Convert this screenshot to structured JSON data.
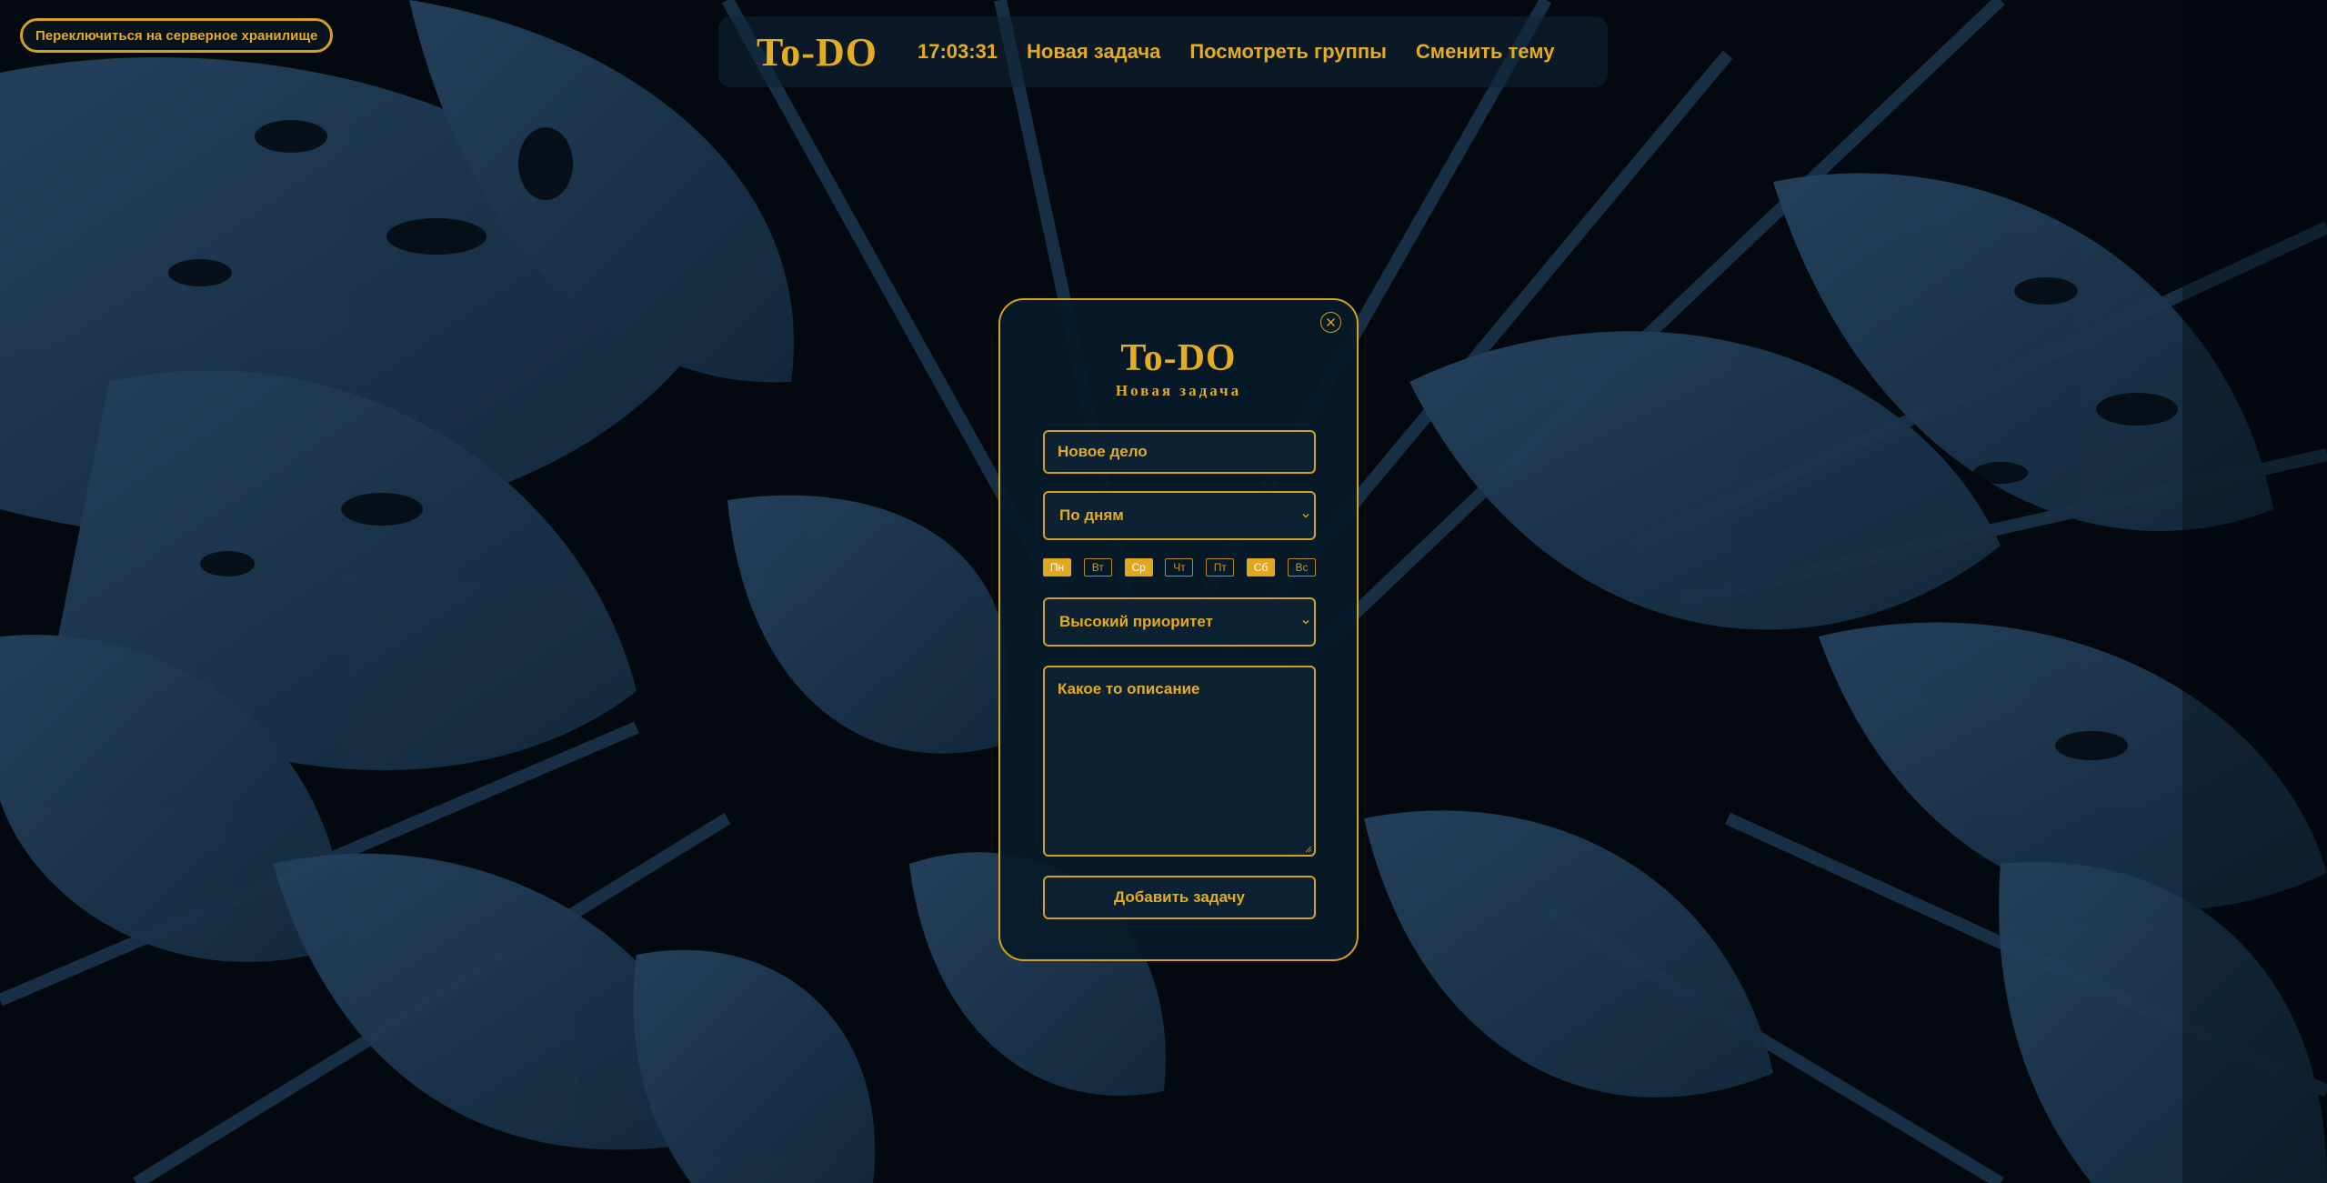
{
  "storage_switch": {
    "label": "Переключиться на серверное хранилище"
  },
  "nav": {
    "brand": "To-DO",
    "clock": "17:03:31",
    "new_task": "Новая задача",
    "view_groups": "Посмотреть группы",
    "change_theme": "Сменить тему"
  },
  "modal": {
    "title": "To-DO",
    "subtitle": "Новая задача",
    "task_name_value": "Новое дело",
    "repeat_select_value": "По дням",
    "days": [
      {
        "label": "Пн",
        "selected": true
      },
      {
        "label": "Вт",
        "selected": false
      },
      {
        "label": "Ср",
        "selected": true
      },
      {
        "label": "Чт",
        "selected": false
      },
      {
        "label": "Пт",
        "selected": false
      },
      {
        "label": "Сб",
        "selected": true
      },
      {
        "label": "Вс",
        "selected": false
      }
    ],
    "priority_select_value": "Высокий приоритет",
    "description_value": "Какое то описание",
    "submit_label": "Добавить задачу"
  },
  "colors": {
    "accent": "#e3ac22",
    "background": "#07121c",
    "panel": "#0c2233",
    "leaf": "#1e3a55"
  },
  "icons": {
    "close": "close-icon",
    "select_arrow": "chevron-down-icon"
  }
}
